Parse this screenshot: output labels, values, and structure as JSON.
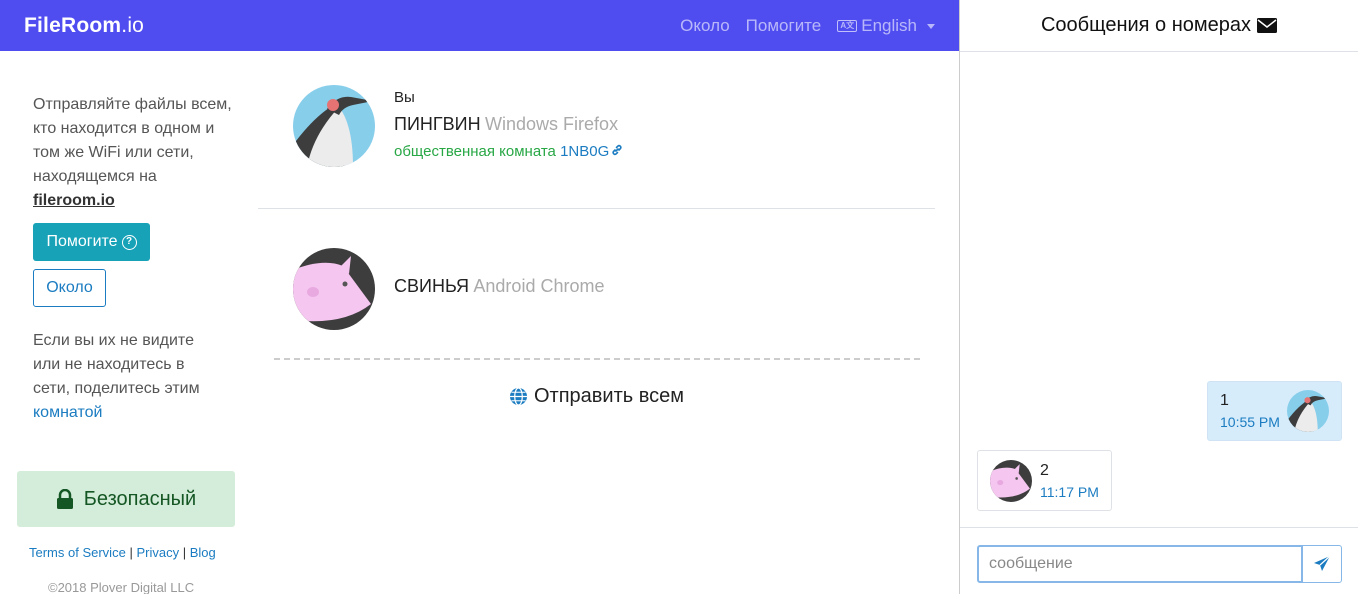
{
  "navbar": {
    "brand_main": "FileRoom",
    "brand_tld": ".io",
    "about": "Около",
    "help": "Помогите",
    "language": "English",
    "language_icon": "translate-icon"
  },
  "sidebar": {
    "intro_text": "Отправляйте файлы всем, кто находится в одном и том же WiFi или сети, находящемся на",
    "intro_link": "fileroom.io",
    "help_button": "Помогите",
    "help_icon": "question-circle-icon",
    "about_button": "Около",
    "share_text": "Если вы их не видите или не находитесь в сети, поделитесь этим",
    "share_link": "комнатой",
    "secure_label": "Безопасный",
    "secure_icon": "lock-icon",
    "footer_links": [
      "Terms of Service",
      "Privacy",
      "Blog"
    ],
    "copyright": "©2018 Plover Digital LLC"
  },
  "main": {
    "self_peer": {
      "you_label": "Вы",
      "name": "ПИНГВИН",
      "device": "Windows Firefox",
      "room_label": "общественная комната",
      "room_code": "1NB0G",
      "room_icon": "link-icon"
    },
    "other_peer": {
      "name": "СВИНЬЯ",
      "device": "Android Chrome"
    },
    "send_all": "Отправить всем",
    "send_all_icon": "globe-icon"
  },
  "chat": {
    "title": "Сообщения о номерах",
    "title_icon": "envelope-icon",
    "messages": [
      {
        "text": "1",
        "time": "10:55 PM",
        "avatar": "penguin-avatar"
      },
      {
        "text": "2",
        "time": "11:17 PM",
        "avatar": "pig-avatar"
      }
    ],
    "input_placeholder": "сообщение",
    "send_icon": "paper-plane-icon"
  },
  "colors": {
    "navbar": "#4f4cf0",
    "help_button": "#17a2b8",
    "link": "#1b7cc1",
    "secure_bg": "#d4edda",
    "room_green": "#28a745"
  }
}
